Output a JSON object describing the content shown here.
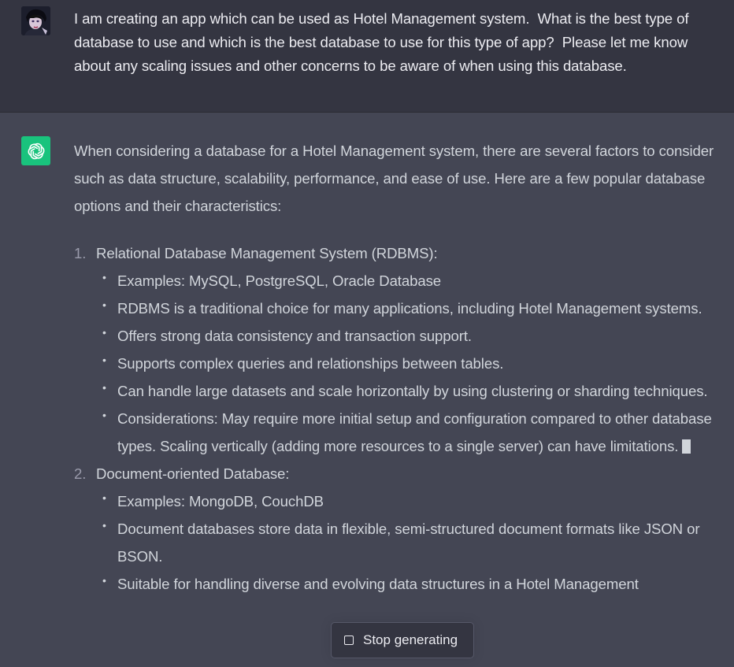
{
  "user_message": {
    "text": "I am creating an app which can be used as Hotel Management system.  What is the best type of database to use and which is the best database to use for this type of app?  Please let me know about any scaling issues and other concerns to be aware of when using this database."
  },
  "assistant_message": {
    "intro": "When considering a database for a Hotel Management system, there are several factors to consider such as data structure, scalability, performance, and ease of use. Here are a few popular database options and their characteristics:",
    "options": [
      {
        "number": "1.",
        "title": "Relational Database Management System (RDBMS):",
        "bullets": [
          "Examples: MySQL, PostgreSQL, Oracle Database",
          "RDBMS is a traditional choice for many applications, including Hotel Management systems.",
          "Offers strong data consistency and transaction support.",
          "Supports complex queries and relationships between tables.",
          "Can handle large datasets and scale horizontally by using clustering or sharding techniques.",
          "Considerations: May require more initial setup and configuration compared to other database types. Scaling vertically (adding more resources to a single server) can have limitations."
        ]
      },
      {
        "number": "2.",
        "title": "Document-oriented Database:",
        "bullets": [
          "Examples: MongoDB, CouchDB",
          "Document databases store data in flexible, semi-structured document formats like JSON or BSON.",
          "Suitable for handling diverse and evolving data structures in a Hotel Management"
        ]
      }
    ]
  },
  "controls": {
    "stop_label": "Stop generating"
  },
  "colors": {
    "user_bg": "#343541",
    "assistant_bg": "#444654",
    "gpt_avatar": "#19c37d"
  }
}
